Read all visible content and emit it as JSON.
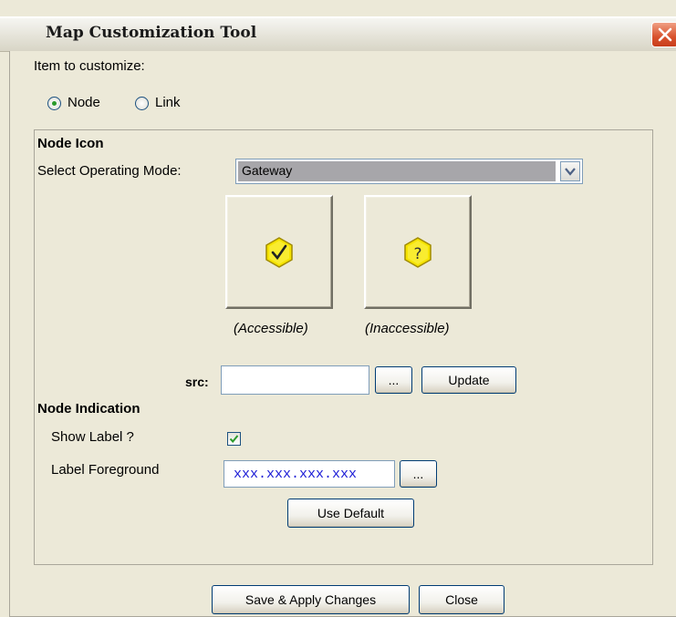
{
  "window": {
    "title": "Map Customization Tool"
  },
  "item_to_customize": {
    "label": "Item to customize:",
    "options": [
      {
        "label": "Node",
        "selected": true
      },
      {
        "label": "Link",
        "selected": false
      }
    ]
  },
  "node_icon": {
    "heading": "Node Icon",
    "operating_mode_label": "Select Operating Mode:",
    "operating_mode_value": "Gateway",
    "previews": [
      {
        "caption": "(Accessible)",
        "icon": "checkmark-hexagon-icon"
      },
      {
        "caption": "(Inaccessible)",
        "icon": "question-hexagon-icon"
      }
    ],
    "src_label": "src:",
    "src_value": "",
    "browse_label": "...",
    "update_label": "Update"
  },
  "node_indication": {
    "heading": "Node Indication",
    "show_label_text": "Show Label ?",
    "show_label_checked": true,
    "label_foreground_text": "Label Foreground",
    "label_foreground_value": "xxx.xxx.xxx.xxx",
    "color_browse_label": "...",
    "use_default_label": "Use Default"
  },
  "footer": {
    "save_label": "Save & Apply Changes",
    "close_label": "Close"
  },
  "colors": {
    "dialog_bg": "#ece9d8",
    "close_button": "#d8512c",
    "icon_yellow": "#f5e300",
    "label_foreground_text": "#1a1ad6",
    "radio_dot": "#2a9a2a",
    "checkbox_check": "#2a9a2a"
  }
}
